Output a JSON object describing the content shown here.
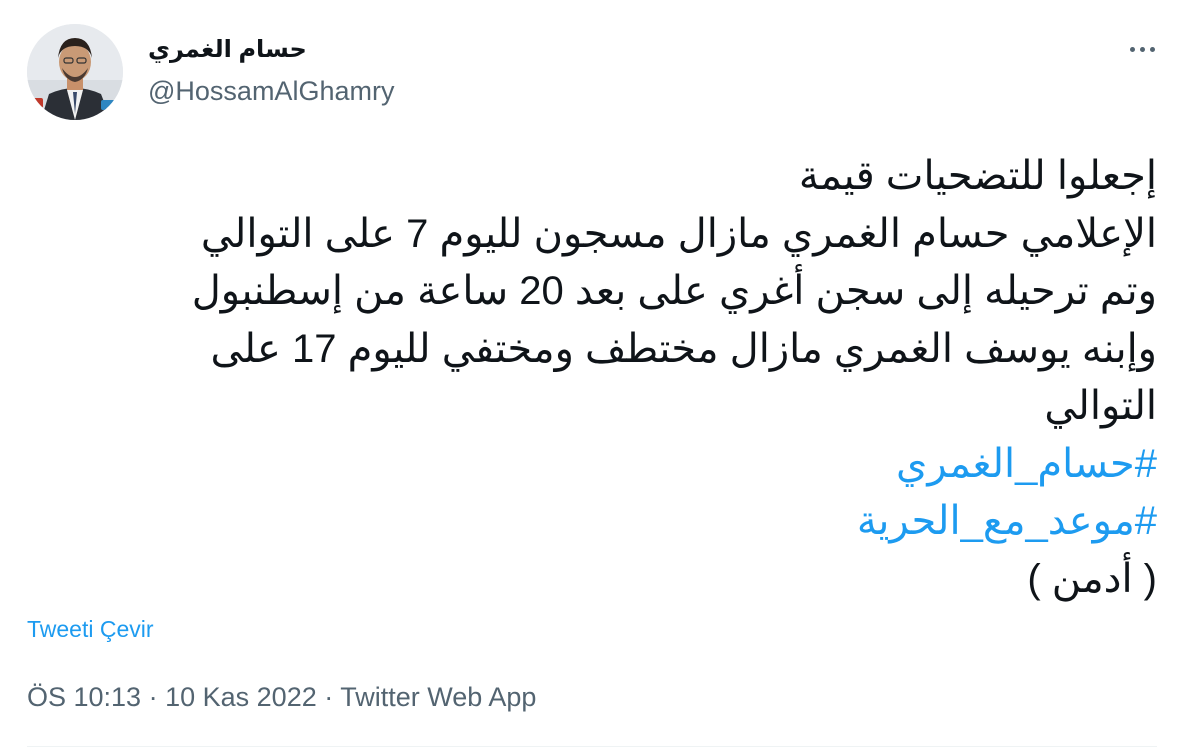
{
  "author": {
    "display_name": "حسام الغمري",
    "handle": "@HossamAlGhamry"
  },
  "tweet": {
    "lines": [
      "إجعلوا للتضحيات قيمة",
      "الإعلامي حسام الغمري مازال مسجون لليوم 7 على التوالي",
      "وتم ترحيله إلى سجن أغري على بعد 20 ساعة من إسطنبول",
      "وإبنه يوسف الغمري مازال مختطف ومختفي لليوم 17 على",
      "التوالي"
    ],
    "hashtags": [
      "#حسام_الغمري",
      "#موعد_مع_الحرية"
    ],
    "signature": "( أدمن )"
  },
  "translate_label": "Tweeti Çevir",
  "meta": {
    "time": "ÖS 10:13",
    "separator": "·",
    "date": "10 Kas 2022",
    "source": "Twitter Web App"
  },
  "icons": {
    "more": "more-options-icon"
  },
  "colors": {
    "link": "#1d9bf0",
    "secondary_text": "#536471",
    "primary_text": "#0f1419"
  }
}
